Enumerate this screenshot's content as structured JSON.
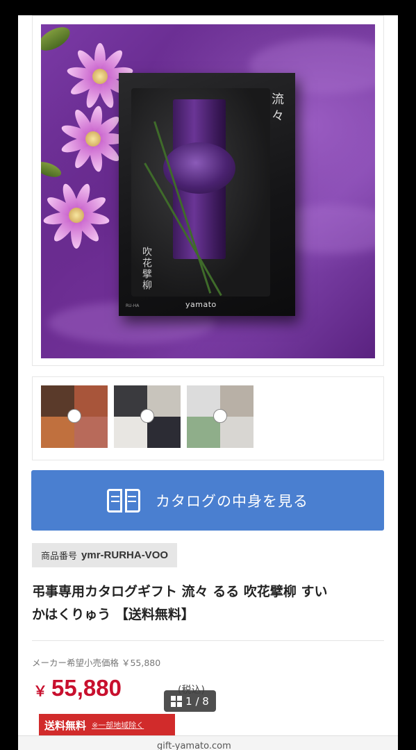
{
  "hero": {
    "catalog_title": "流々",
    "catalog_subtitle": "吹花擘柳",
    "catalog_code": "RU-HA",
    "brand": "yamato"
  },
  "catalog_button": {
    "label": "カタログの中身を見る",
    "icon": "book-icon"
  },
  "sku": {
    "label": "商品番号",
    "value": "ymr-RURHA-VOO"
  },
  "product": {
    "title_line1": "弔事専用カタログギフト 流々 るる 吹花擘柳 すい",
    "title_line2": "かはくりゅう 【送料無料】"
  },
  "pricing": {
    "msrp_text": "メーカー希望小売価格 ￥55,880",
    "currency": "￥",
    "price": "55,880",
    "tax_label": "(税込)"
  },
  "shipping": {
    "badge": "送料無料",
    "note": "※一部地域除く"
  },
  "pager": {
    "text": "1 / 8",
    "icon": "grid-icon"
  },
  "bottom": {
    "url": "gift-yamato.com"
  },
  "colors": {
    "accent": "#4a7fd0",
    "price": "#c8102e",
    "shipping": "#d12b2b"
  }
}
